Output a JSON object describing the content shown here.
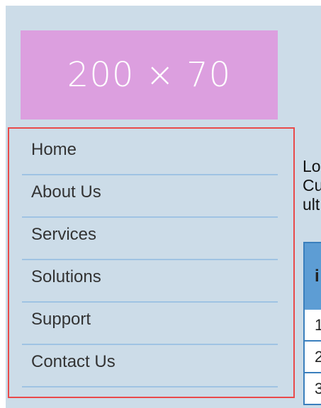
{
  "logo": {
    "text": "200 × 70"
  },
  "nav": {
    "items": [
      {
        "label": "Home"
      },
      {
        "label": "About Us"
      },
      {
        "label": "Services"
      },
      {
        "label": "Solutions"
      },
      {
        "label": "Support"
      },
      {
        "label": "Contact Us"
      }
    ]
  },
  "content": {
    "intro_lines": [
      "Lo",
      "Cu",
      "ult"
    ]
  },
  "table": {
    "header": "i",
    "rows": [
      "1",
      "2",
      "3"
    ]
  },
  "colors": {
    "page_background": "#ccdce8",
    "logo_background": "#dc9fdf",
    "nav_border": "#e94a4a",
    "nav_divider": "#9fc3e3",
    "table_header": "#5d9dd4"
  }
}
